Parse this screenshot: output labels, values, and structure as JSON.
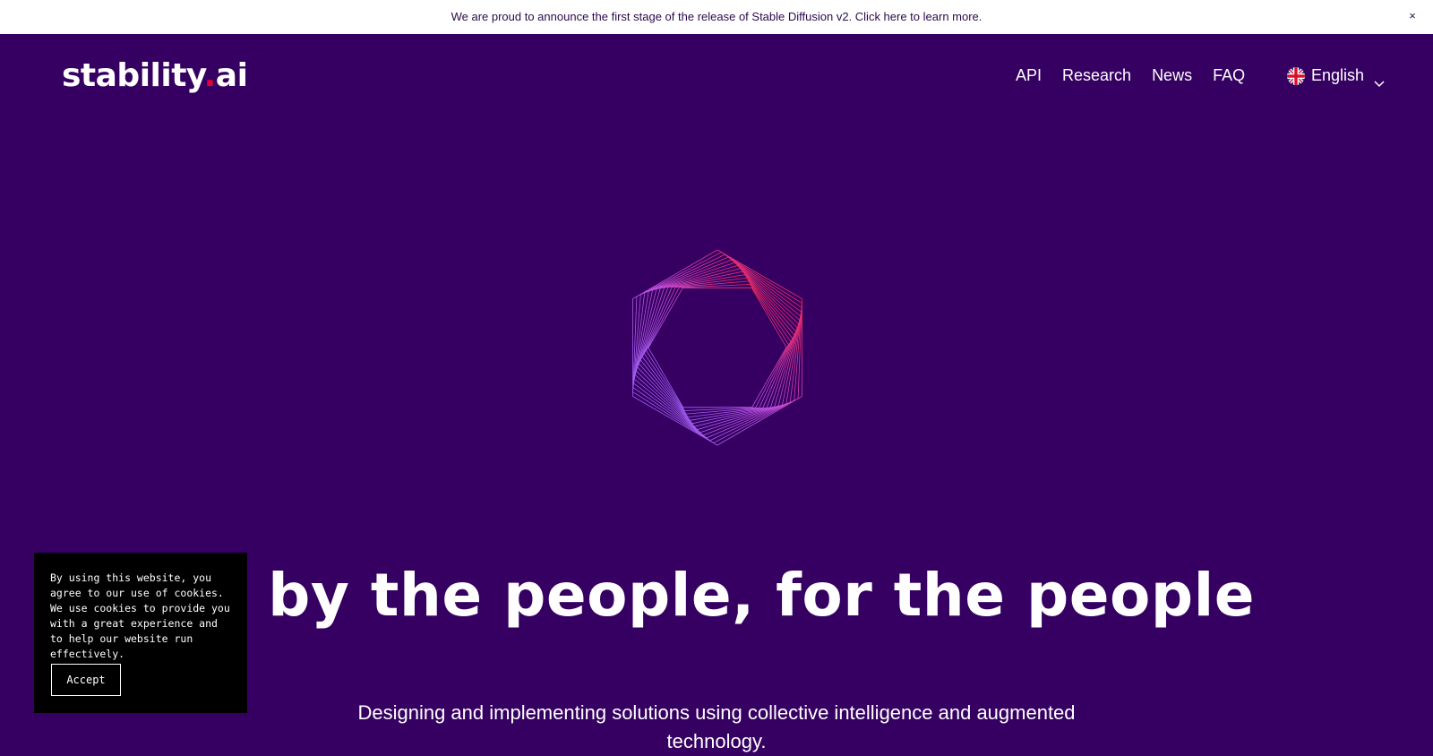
{
  "announcement": {
    "text": "We are proud to announce the first stage of the release of Stable Diffusion v2. Click here to learn more.",
    "close_glyph": "×"
  },
  "header": {
    "logo_main": "stability",
    "logo_dot": ".",
    "logo_suffix": "ai",
    "nav": [
      "API",
      "Research",
      "News",
      "FAQ"
    ],
    "language": "English",
    "language_icon": "uk-flag-icon"
  },
  "hero": {
    "title": "AI by the people, for the people",
    "subtitle": "Designing and implementing solutions using collective intelligence and augmented technology."
  },
  "cookie_banner": {
    "text": "By using this website, you agree to our use of cookies. We use cookies to provide you with a great experience and to help our website run effectively.",
    "accept_label": "Accept"
  },
  "colors": {
    "background": "#350061",
    "accent_red": "#e5003c",
    "gradient_start": "#8f66ff",
    "gradient_end": "#ff1a2e"
  }
}
